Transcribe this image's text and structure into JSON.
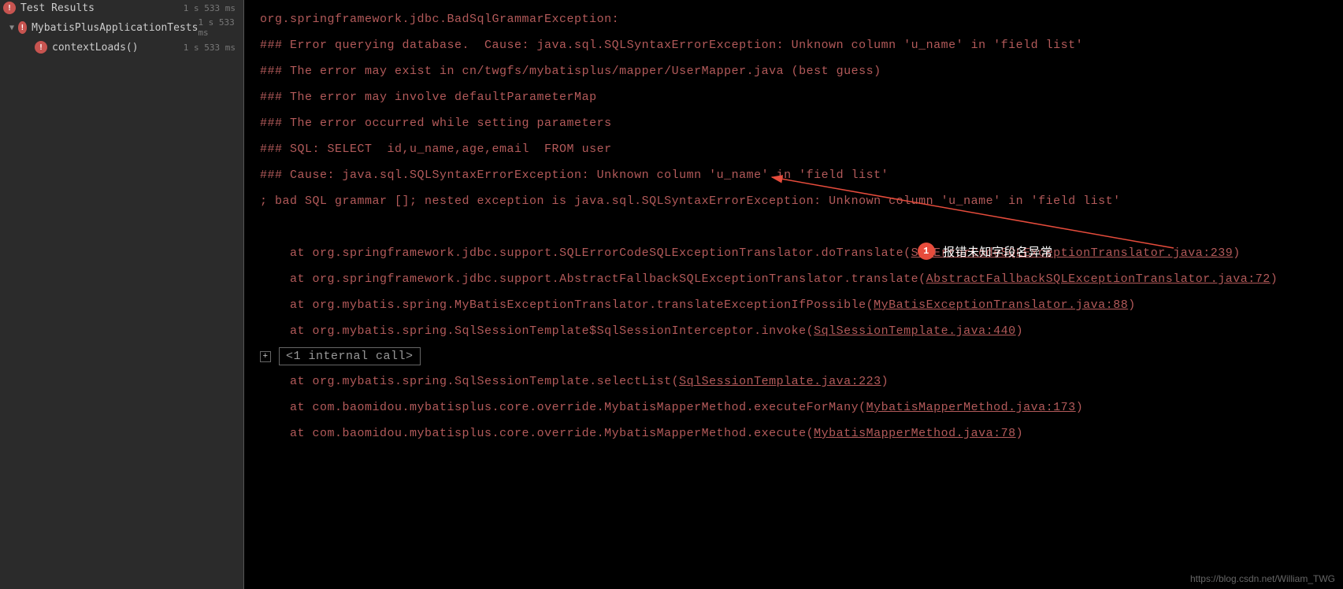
{
  "sidebar": {
    "root": {
      "label": "Test Results",
      "time": "1 s 533 ms"
    },
    "class": {
      "label": "MybatisPlusApplicationTests",
      "time": "1 s 533 ms"
    },
    "method": {
      "label": "contextLoads()",
      "time": "1 s 533 ms"
    }
  },
  "console": {
    "l1": "org.springframework.jdbc.BadSqlGrammarException: ",
    "l2": "### Error querying database.  Cause: java.sql.SQLSyntaxErrorException: Unknown column 'u_name' in 'field list'",
    "l3": "### The error may exist in cn/twgfs/mybatisplus/mapper/UserMapper.java (best guess)",
    "l4": "### The error may involve defaultParameterMap",
    "l5": "### The error occurred while setting parameters",
    "l6": "### SQL: SELECT  id,u_name,age,email  FROM user",
    "l7": "### Cause: java.sql.SQLSyntaxErrorException: Unknown column 'u_name' in 'field list'",
    "l8": "; bad SQL grammar []; nested exception is java.sql.SQLSyntaxErrorException: Unknown column 'u_name' in 'field list'",
    "l9a": "    at org.springframework.jdbc.support.SQLErrorCodeSQLExceptionTranslator.doTranslate(",
    "l9b": "SQLErrorCodeSQLExceptionTranslator.java:239",
    "l9c": ")",
    "l10a": "    at org.springframework.jdbc.support.AbstractFallbackSQLExceptionTranslator.translate(",
    "l10b": "AbstractFallbackSQLExceptionTranslator.java:72",
    "l10c": ")",
    "l11a": "    at org.mybatis.spring.MyBatisExceptionTranslator.translateExceptionIfPossible(",
    "l11b": "MyBatisExceptionTranslator.java:88",
    "l11c": ")",
    "l12a": "    at org.mybatis.spring.SqlSessionTemplate$SqlSessionInterceptor.invoke(",
    "l12b": "SqlSessionTemplate.java:440",
    "l12c": ")",
    "fold": "<1 internal call>",
    "l13a": "    at org.mybatis.spring.SqlSessionTemplate.selectList(",
    "l13b": "SqlSessionTemplate.java:223",
    "l13c": ")",
    "l14a": "    at com.baomidou.mybatisplus.core.override.MybatisMapperMethod.executeForMany(",
    "l14b": "MybatisMapperMethod.java:173",
    "l14c": ")",
    "l15a": "    at com.baomidou.mybatisplus.core.override.MybatisMapperMethod.execute(",
    "l15b": "MybatisMapperMethod.java:78",
    "l15c": ")"
  },
  "annotation": {
    "number": "1",
    "text": "报错未知字段名异常"
  },
  "watermark": "https://blog.csdn.net/William_TWG"
}
